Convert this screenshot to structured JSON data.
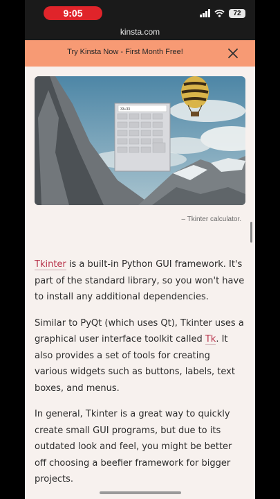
{
  "status_bar": {
    "time": "9:05",
    "battery": "72"
  },
  "browser": {
    "url": "kinsta.com"
  },
  "promo": {
    "text": "Try Kinsta Now - First Month Free!"
  },
  "figure": {
    "calculator_display": "33+33",
    "caption": "– Tkinter calculator."
  },
  "article": {
    "p1": {
      "link": "Tkinter",
      "text": " is a built-in Python GUI framework. It's part of the standard library, so you won't have to install any additional dependencies."
    },
    "p2": {
      "text_before": "Similar to PyQt (which uses Qt), Tkinter uses a graphical user interface toolkit called ",
      "link": "Tk",
      "text_after": ". It also provides a set of tools for creating various widgets such as buttons, labels, text boxes, and menus."
    },
    "p3": {
      "text": "In general, Tkinter is a great way to quickly create small GUI programs, but due to its outdated look and feel, you might be better off choosing a beefier framework for bigger projects."
    }
  }
}
